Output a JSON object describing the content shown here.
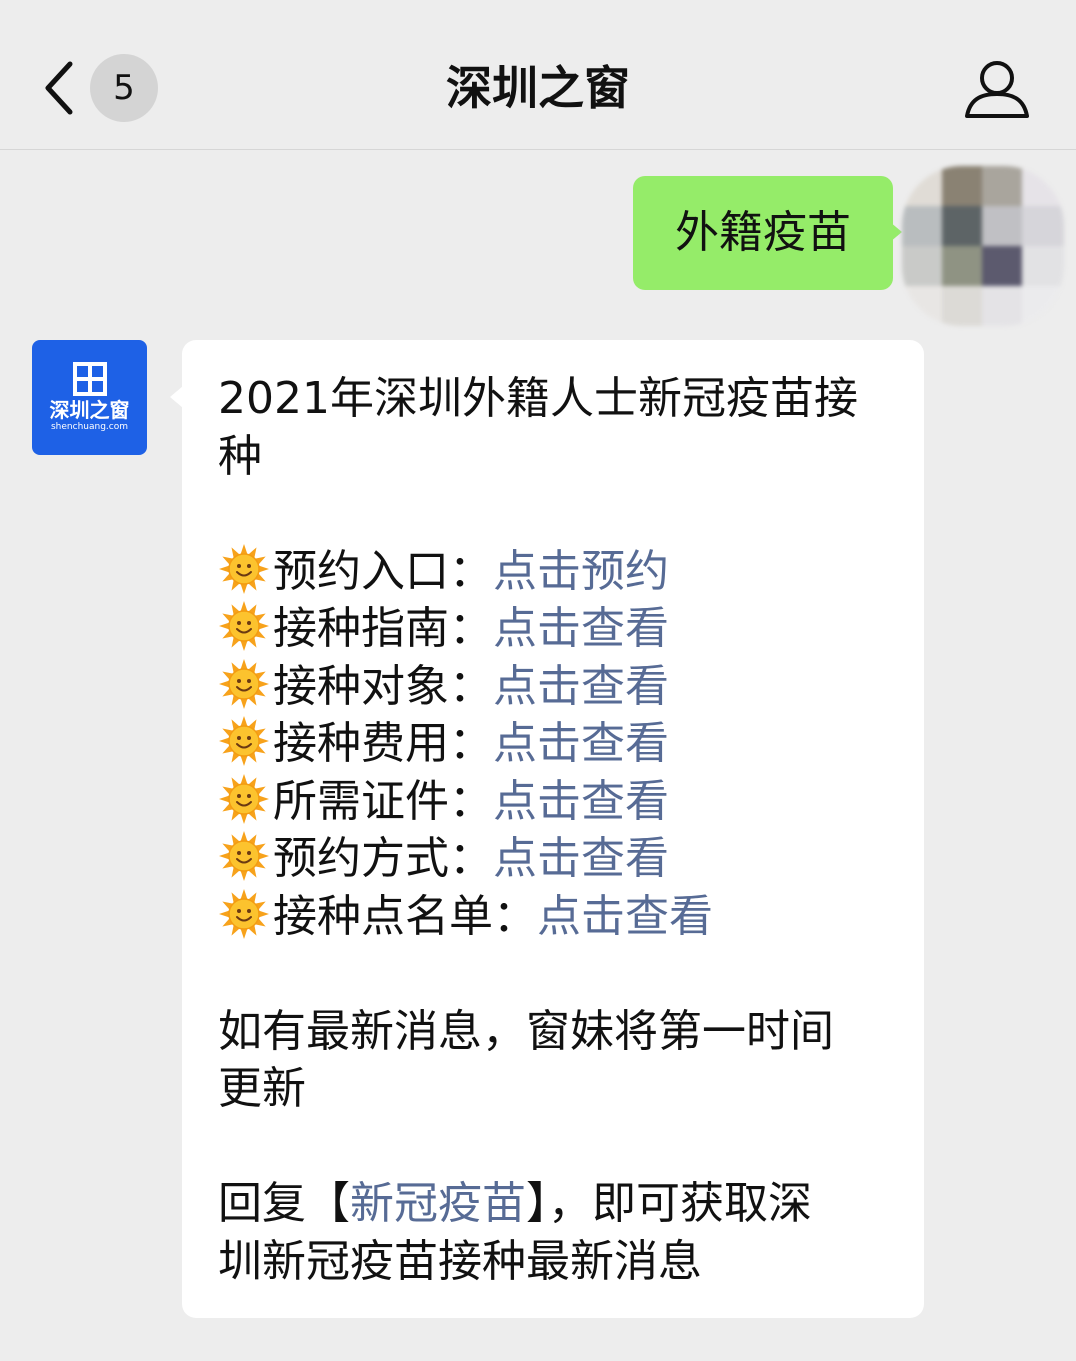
{
  "header": {
    "back_label": "back",
    "unread_count": "5",
    "title": "深圳之窗",
    "profile_icon": "person-icon"
  },
  "chat": {
    "sent_message": "外籍疫苗",
    "official_account": {
      "logo_text": "深圳之窗",
      "logo_url": "shenchuang.com",
      "brand_color": "#1e61e6"
    },
    "reply": {
      "title_line1": "2021年深圳外籍人士新冠疫苗接",
      "title_line2": "种",
      "items": [
        {
          "label": "预约入口：",
          "link": "点击预约"
        },
        {
          "label": "接种指南：",
          "link": "点击查看"
        },
        {
          "label": "接种对象：",
          "link": "点击查看"
        },
        {
          "label": "接种费用：",
          "link": "点击查看"
        },
        {
          "label": "所需证件：",
          "link": "点击查看"
        },
        {
          "label": "预约方式：",
          "link": "点击查看"
        },
        {
          "label": "接种点名单：",
          "link": "点击查看"
        }
      ],
      "update_line1": "如有最新消息，窗妹将第一时间",
      "update_line2": "更新",
      "reply_prefix": "回复",
      "reply_open": "【",
      "reply_keyword": "新冠疫苗",
      "reply_close": "】",
      "reply_suffix": "，即可获取深",
      "reply_line2": "圳新冠疫苗接种最新消息"
    }
  },
  "colors": {
    "background": "#ededed",
    "sent_bubble": "#95ec69",
    "link": "#576b95"
  }
}
